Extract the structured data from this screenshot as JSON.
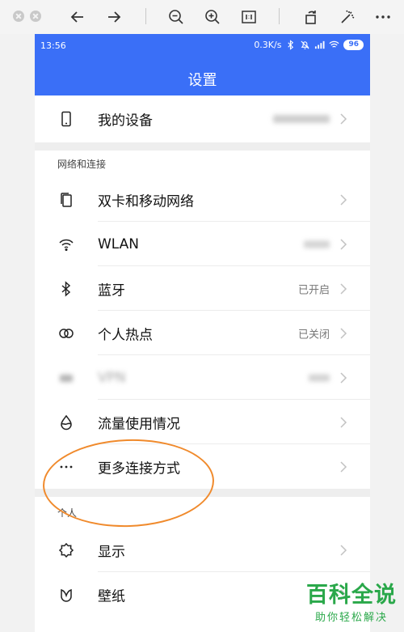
{
  "status_bar": {
    "time": "13:56",
    "speed": "0.3K/s",
    "battery": "96",
    "icons": [
      "bluetooth-icon",
      "mute-icon",
      "signal-icon",
      "wifi-icon",
      "battery-icon"
    ]
  },
  "header": {
    "title": "设置"
  },
  "device_row": {
    "label": "我的设备",
    "value": "",
    "icon": "phone-icon"
  },
  "network_section": {
    "title": "网络和连接",
    "items": [
      {
        "label": "双卡和移动网络",
        "value": "",
        "icon": "sim-card-icon"
      },
      {
        "label": "WLAN",
        "value": "",
        "icon": "wifi-icon"
      },
      {
        "label": "蓝牙",
        "value": "已开启",
        "icon": "bluetooth-icon"
      },
      {
        "label": "个人热点",
        "value": "已关闭",
        "icon": "hotspot-icon"
      },
      {
        "label": "VPN",
        "value": "",
        "icon": "vpn-icon"
      },
      {
        "label": "流量使用情况",
        "value": "",
        "icon": "data-usage-icon"
      },
      {
        "label": "更多连接方式",
        "value": "",
        "icon": "more-icon"
      }
    ]
  },
  "personal_section": {
    "title": "个人",
    "items": [
      {
        "label": "显示",
        "value": "",
        "icon": "brightness-icon"
      },
      {
        "label": "壁纸",
        "value": "",
        "icon": "wallpaper-icon"
      }
    ]
  },
  "watermark": {
    "logo": "百科全说",
    "subtitle": "助你轻松解决"
  },
  "colors": {
    "accent": "#3a6ff7",
    "highlight": "#f08a2c",
    "watermark": "#2aa84a"
  }
}
